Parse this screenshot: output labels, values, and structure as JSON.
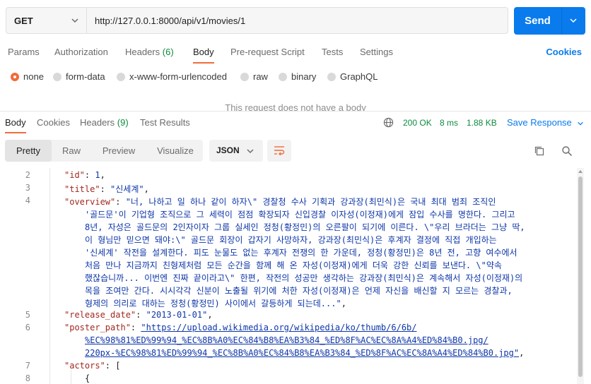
{
  "request": {
    "method": "GET",
    "url": "http://127.0.0.1:8000/api/v1/movies/1",
    "send_label": "Send"
  },
  "request_tabs": [
    {
      "label": "Params"
    },
    {
      "label": "Authorization"
    },
    {
      "label": "Headers",
      "count": "(6)"
    },
    {
      "label": "Body"
    },
    {
      "label": "Pre-request Script"
    },
    {
      "label": "Tests"
    },
    {
      "label": "Settings"
    }
  ],
  "cookies_link": "Cookies",
  "body_types": [
    "none",
    "form-data",
    "x-www-form-urlencoded",
    "raw",
    "binary",
    "GraphQL"
  ],
  "no_body_text": "This request does not have a body",
  "response_tabs": [
    {
      "label": "Body"
    },
    {
      "label": "Cookies"
    },
    {
      "label": "Headers",
      "count": "(9)"
    },
    {
      "label": "Test Results"
    }
  ],
  "response_status": {
    "status": "200 OK",
    "time": "8 ms",
    "size": "1.88 KB"
  },
  "save_response": "Save Response",
  "view_modes": [
    "Pretty",
    "Raw",
    "Preview",
    "Visualize"
  ],
  "format": "JSON",
  "icons": {
    "globe": "globe-icon",
    "wrap": "wrap-lines-icon",
    "copy": "copy-icon",
    "search": "search-icon"
  },
  "code": {
    "line_numbers": [
      "2",
      "3",
      "4",
      "5",
      "6",
      "7",
      "8"
    ],
    "id_key": "\"id\"",
    "id_val": "1",
    "title_key": "\"title\"",
    "title_val": "\"신세계\"",
    "overview_key": "\"overview\"",
    "overview_lines": [
      "\"너, 나하고 일 하나 같이 하자\\\" 경찰청 수사 기획과 강과장(최민식)은 국내 최대 범죄 조직인",
      "'골드문'이 기업형 조직으로 그 세력이 점점 확장되자 신입경찰 이자성(이정재)에게 잠입 수사를 명한다. 그리고",
      "8년, 자성은 골드문의 2인자이자 그룹 실세인 정청(황정민)의 오른팔이 되기에 이른다. \\\"우리 브라더는 그냥 딱,",
      "이 형님만 믿으면 돼야:\\\" 골드문 회장이 갑자기 사망하자, 강과장(최민식)은 후계자 결정에 직접 개입하는",
      "'신세계' 작전을 설계한다. 피도 눈물도 없는 후계자 전쟁의 한 가운데, 정청(황정민)은 8년 전, 고향 여수에서",
      "처음 만나 지금까지 친형제처럼 모든 순간을 함께 해 온 자성(이정재)에게 더욱 강한 신뢰를 보낸다. \\\"약속",
      "했잖습니까... 이번엔 진짜 끝이라고\\\" 한편, 작전의 성공만 생각하는 강과장(최민식)은 계속해서 자성(이정재)의",
      "목을 조여만 간다. 시시각각 신분이 노출될 위기에 처한 자성(이정재)은 언제 자신을 배신할 지 모르는 경찰과,",
      "형제의 의리로 대하는 정청(황정민) 사이에서 갈등하게 되는데...\""
    ],
    "release_key": "\"release_date\"",
    "release_val": "\"2013-01-01\"",
    "poster_key": "\"poster_path\"",
    "poster_lines": [
      "\"https://upload.wikimedia.org/wikipedia/ko/thumb/6/6b/",
      "%EC%98%81%ED%99%94_%EC%8B%A0%EC%84%B8%EA%B3%84_%ED%8F%AC%EC%8A%A4%ED%84%B0.jpg/",
      "220px-%EC%98%81%ED%99%94_%EC%8B%A0%EC%84%B8%EA%B3%84_%ED%8F%AC%EC%8A%A4%ED%84%B0.jpg\""
    ],
    "actors_key": "\"actors\"",
    "open_bracket": "[",
    "open_brace": "{"
  }
}
